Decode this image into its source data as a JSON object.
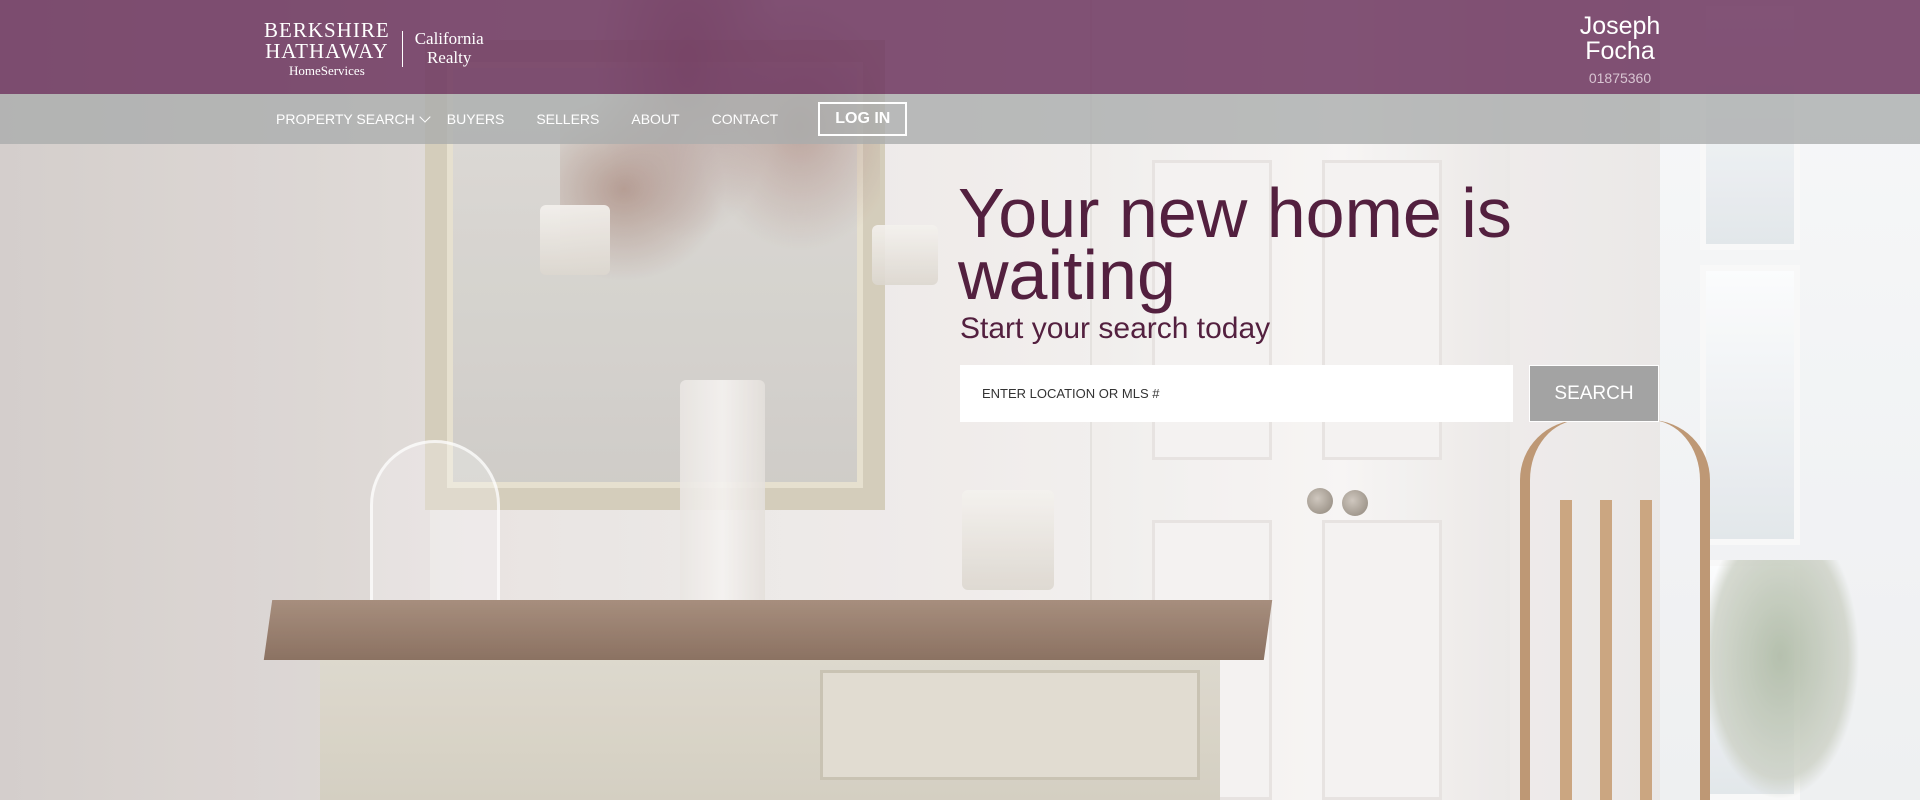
{
  "brand": {
    "line1": "BERKSHIRE",
    "line2": "HATHAWAY",
    "line3": "HomeServices",
    "region_line1": "California",
    "region_line2": "Realty"
  },
  "agent": {
    "first_name": "Joseph",
    "last_name": "Focha",
    "license": "01875360"
  },
  "nav": {
    "items": [
      {
        "label": "PROPERTY SEARCH",
        "has_dropdown": true
      },
      {
        "label": "BUYERS"
      },
      {
        "label": "SELLERS"
      },
      {
        "label": "ABOUT"
      },
      {
        "label": "CONTACT"
      }
    ],
    "login_label": "LOG IN"
  },
  "hero": {
    "headline": "Your new home is waiting",
    "subheadline": "Start your search today",
    "search_placeholder": "ENTER LOCATION OR MLS #",
    "search_button": "SEARCH"
  },
  "colors": {
    "brand_purple": "#6e375f",
    "headline_purple": "#53203f",
    "nav_gray": "#aaacad",
    "search_button_gray": "#a3a3a3"
  },
  "icons": {
    "dropdown": "chevron-down-icon"
  }
}
